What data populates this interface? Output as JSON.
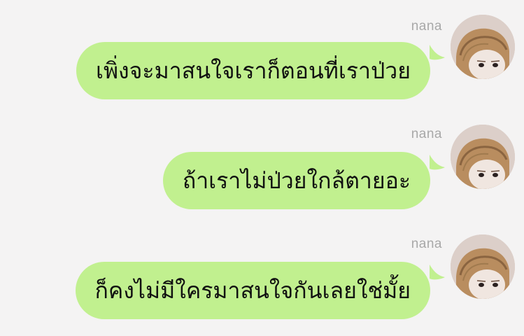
{
  "messages": [
    {
      "sender": "nana",
      "text": "เพิ่งจะมาสนใจเราก็ตอนที่เราป่วย",
      "avatar_icon": "user-avatar-photo"
    },
    {
      "sender": "nana",
      "text": "ถ้าเราไม่ป่วยใกล้ตายอะ",
      "avatar_icon": "user-avatar-photo"
    },
    {
      "sender": "nana",
      "text": "ก็คงไม่มีใครมาสนใจกันเลยใช่มั้ย",
      "avatar_icon": "user-avatar-photo"
    }
  ],
  "colors": {
    "background": "#f4f3f3",
    "bubble": "#c1f08f",
    "sender_name": "#a8a8a8",
    "text": "#111111"
  }
}
